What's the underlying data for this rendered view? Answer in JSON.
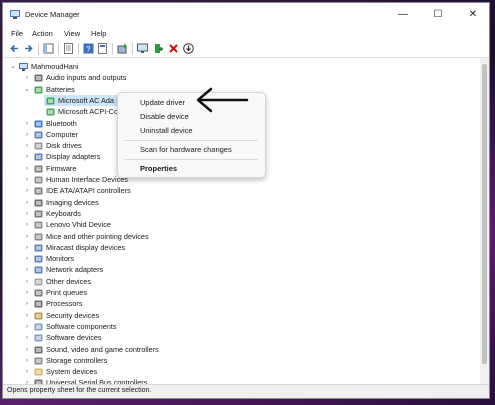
{
  "window": {
    "title": "Device Manager",
    "controls": {
      "minimize": "—",
      "maximize": "☐",
      "close": "✕"
    }
  },
  "menu": [
    "File",
    "Action",
    "View",
    "Help"
  ],
  "tree": {
    "root": "MahmoudHani",
    "items": [
      {
        "label": "Audio inputs and outputs",
        "level": 1,
        "expander": "›",
        "icon": "speaker-icon"
      },
      {
        "label": "Batteries",
        "level": 1,
        "expander": "⌄",
        "icon": "battery-icon"
      },
      {
        "label": "Microsoft AC Ada",
        "level": 2,
        "expander": "",
        "icon": "battery-icon"
      },
      {
        "label": "Microsoft ACPI-Co",
        "level": 2,
        "expander": "",
        "icon": "battery-icon"
      },
      {
        "label": "Bluetooth",
        "level": 1,
        "expander": "›",
        "icon": "bluetooth-icon"
      },
      {
        "label": "Computer",
        "level": 1,
        "expander": "›",
        "icon": "computer-icon"
      },
      {
        "label": "Disk drives",
        "level": 1,
        "expander": "›",
        "icon": "disk-icon"
      },
      {
        "label": "Display adapters",
        "level": 1,
        "expander": "›",
        "icon": "display-icon"
      },
      {
        "label": "Firmware",
        "level": 1,
        "expander": "›",
        "icon": "chip-icon"
      },
      {
        "label": "Human Interface Devices",
        "level": 1,
        "expander": "›",
        "icon": "hid-icon"
      },
      {
        "label": "IDE ATA/ATAPI controllers",
        "level": 1,
        "expander": "›",
        "icon": "controller-icon"
      },
      {
        "label": "Imaging devices",
        "level": 1,
        "expander": "›",
        "icon": "camera-icon"
      },
      {
        "label": "Keyboards",
        "level": 1,
        "expander": "›",
        "icon": "keyboard-icon"
      },
      {
        "label": "Lenovo Vhid Device",
        "level": 1,
        "expander": "›",
        "icon": "hid-icon"
      },
      {
        "label": "Mice and other pointing devices",
        "level": 1,
        "expander": "›",
        "icon": "mouse-icon"
      },
      {
        "label": "Miracast display devices",
        "level": 1,
        "expander": "›",
        "icon": "display-icon"
      },
      {
        "label": "Monitors",
        "level": 1,
        "expander": "›",
        "icon": "monitor-icon"
      },
      {
        "label": "Network adapters",
        "level": 1,
        "expander": "›",
        "icon": "network-icon"
      },
      {
        "label": "Other devices",
        "level": 1,
        "expander": "›",
        "icon": "unknown-device-icon"
      },
      {
        "label": "Print queues",
        "level": 1,
        "expander": "›",
        "icon": "printer-icon"
      },
      {
        "label": "Processors",
        "level": 1,
        "expander": "›",
        "icon": "processor-icon"
      },
      {
        "label": "Security devices",
        "level": 1,
        "expander": "›",
        "icon": "key-icon"
      },
      {
        "label": "Software components",
        "level": 1,
        "expander": "›",
        "icon": "puzzle-icon"
      },
      {
        "label": "Software devices",
        "level": 1,
        "expander": "›",
        "icon": "puzzle-icon"
      },
      {
        "label": "Sound, video and game controllers",
        "level": 1,
        "expander": "›",
        "icon": "speaker-icon"
      },
      {
        "label": "Storage controllers",
        "level": 1,
        "expander": "›",
        "icon": "storage-icon"
      },
      {
        "label": "System devices",
        "level": 1,
        "expander": "›",
        "icon": "folder-icon"
      },
      {
        "label": "Universal Serial Bus controllers",
        "level": 1,
        "expander": "›",
        "icon": "usb-icon"
      }
    ]
  },
  "context_menu": {
    "update_driver": "Update driver",
    "disable_device": "Disable device",
    "uninstall_device": "Uninstall device",
    "scan": "Scan for hardware changes",
    "properties": "Properties"
  },
  "status": "Opens property sheet for the current selection.",
  "colors": {
    "selection": "#cce4f7",
    "accent": "#0063b1",
    "delete": "#d01010"
  }
}
